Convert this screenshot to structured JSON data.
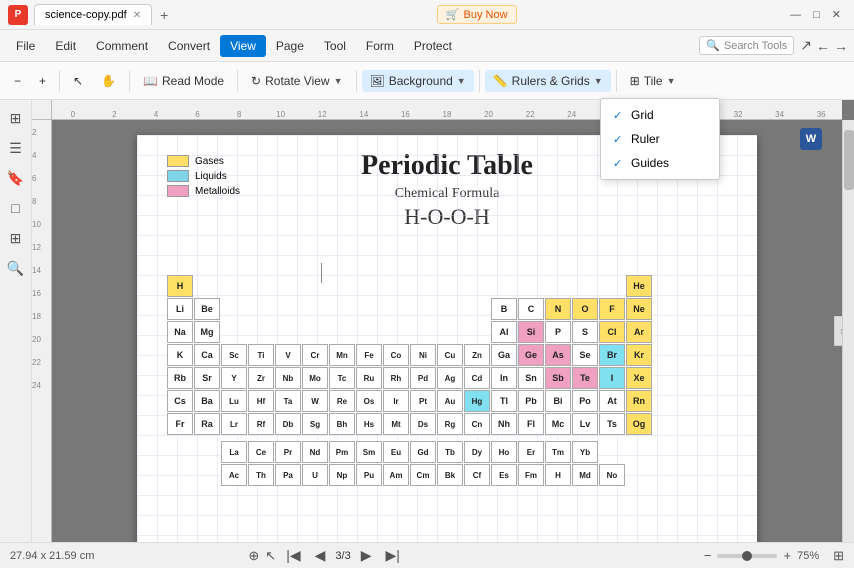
{
  "titlebar": {
    "app_icon": "P",
    "tab_title": "science-copy.pdf",
    "close_label": "✕",
    "add_tab": "+",
    "buy_now": "Buy Now",
    "win_controls": [
      "—",
      "□",
      "✕"
    ]
  },
  "menubar": {
    "items": [
      "File",
      "Edit",
      "Comment",
      "Convert",
      "View",
      "Page",
      "Tool",
      "Form",
      "Protect"
    ],
    "active": "View",
    "search_placeholder": "Search Tools"
  },
  "toolbar": {
    "zoom_out": "−",
    "zoom_in": "+",
    "read_mode": "Read Mode",
    "rotate_view": "Rotate View",
    "background": "Background",
    "rulers_grids": "Rulers & Grids",
    "tile": "Tile",
    "rulers_dropdown": {
      "items": [
        {
          "label": "Grid",
          "checked": true
        },
        {
          "label": "Ruler",
          "checked": true
        },
        {
          "label": "Guides",
          "checked": true
        }
      ]
    }
  },
  "left_tools": {
    "icons": [
      "⊞",
      "☰",
      "🔖",
      "□",
      "⊞",
      "🔍"
    ]
  },
  "page": {
    "title": "Periodic Table",
    "formula_label": "Chemical Formula",
    "formula": "H-O-O-H",
    "legend": [
      {
        "label": "Gases",
        "color": "#ffe066"
      },
      {
        "label": "Liquids",
        "color": "#80d4e8"
      },
      {
        "label": "Metalloids",
        "color": "#f0a0c0"
      }
    ]
  },
  "statusbar": {
    "dimensions": "27.94 x 21.59 cm",
    "page_current": "3",
    "page_total": "3",
    "zoom": "75%"
  }
}
